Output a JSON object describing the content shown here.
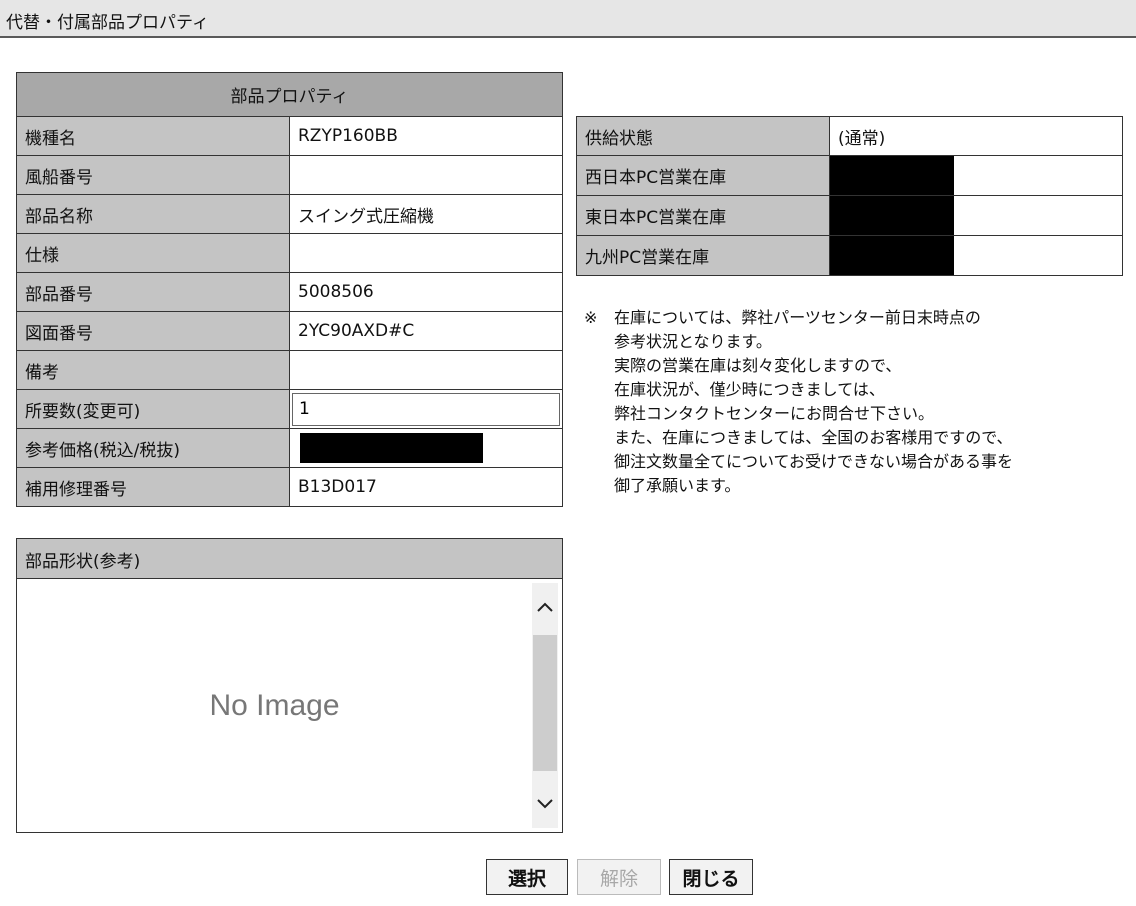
{
  "window": {
    "title": "代替・付属部品プロパティ"
  },
  "properties": {
    "header": "部品プロパティ",
    "rows": [
      {
        "label": "機種名",
        "value": "RZYP160BB"
      },
      {
        "label": "風船番号",
        "value": ""
      },
      {
        "label": "部品名称",
        "value": "スイング式圧縮機"
      },
      {
        "label": "仕様",
        "value": ""
      },
      {
        "label": "部品番号",
        "value": "5008506"
      },
      {
        "label": "図面番号",
        "value": "2YC90AXD#C"
      },
      {
        "label": "備考",
        "value": ""
      },
      {
        "label": "所要数(変更可)",
        "value": "1"
      },
      {
        "label": "参考価格(税込/税抜)",
        "value": "",
        "redacted": true
      },
      {
        "label": "補用修理番号",
        "value": "B13D017"
      }
    ]
  },
  "supply": {
    "rows": [
      {
        "label": "供給状態",
        "value": "(通常)"
      },
      {
        "label": "西日本PC営業在庫",
        "value": "",
        "redacted": true
      },
      {
        "label": "東日本PC営業在庫",
        "value": "",
        "redacted": true
      },
      {
        "label": "九州PC営業在庫",
        "value": "",
        "redacted": true
      }
    ]
  },
  "note": {
    "mark": "※",
    "lines": [
      "在庫については、弊社パーツセンター前日末時点の",
      "参考状況となります。",
      "実際の営業在庫は刻々変化しますので、",
      "在庫状況が、僅少時につきましては、",
      "弊社コンタクトセンターにお問合せ下さい。",
      "また、在庫につきましては、全国のお客様用ですので、",
      "御注文数量全てについてお受けできない場合がある事を",
      "御了承願います。"
    ]
  },
  "shape": {
    "header": "部品形状(参考)",
    "placeholder": "No Image"
  },
  "buttons": {
    "select": "選択",
    "release": "解除",
    "close": "閉じる"
  }
}
